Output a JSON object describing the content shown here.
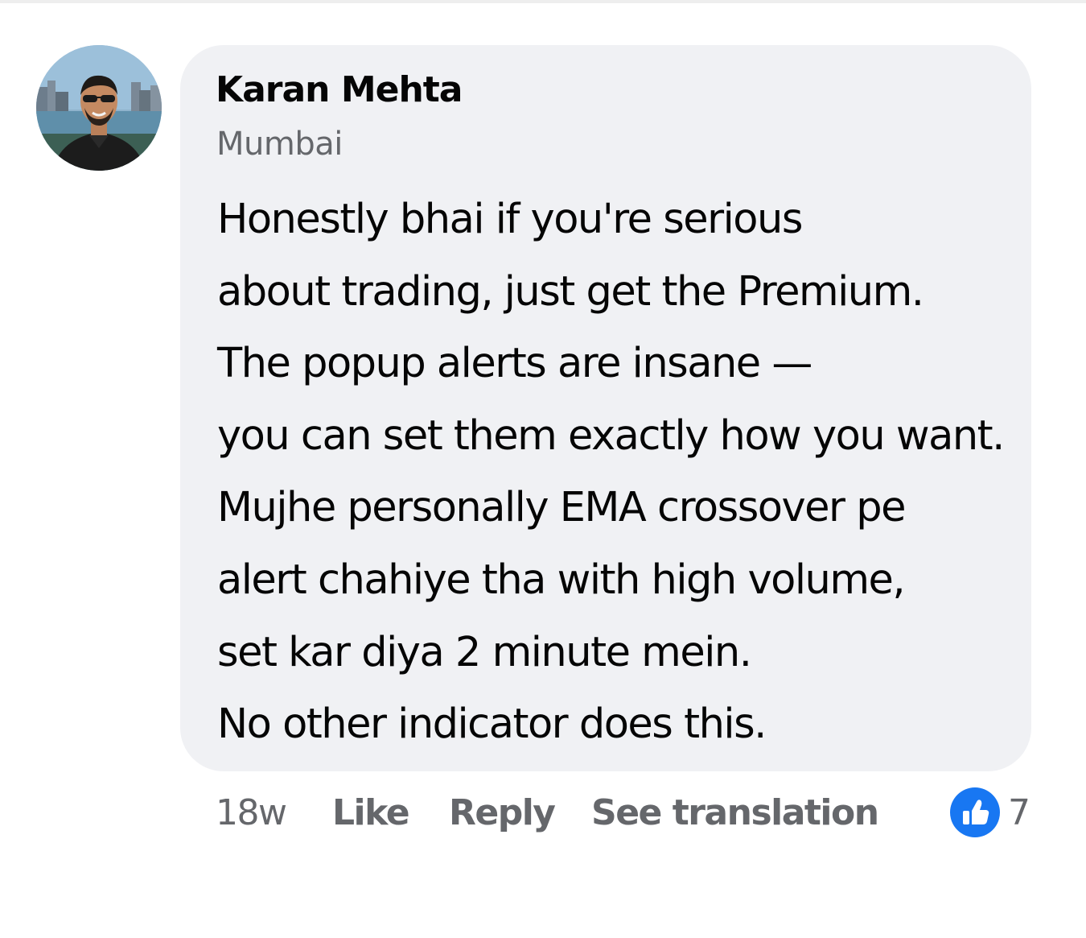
{
  "comment": {
    "author_name": "Karan Mehta",
    "author_location": "Mumbai",
    "avatar_icon": "profile-photo",
    "lines": [
      "Honestly bhai if you're serious",
      "about trading, just get the Premium.",
      "The popup alerts are insane —",
      "you can set them exactly how you want.",
      "Mujhe personally EMA crossover pe",
      "alert chahiye tha with high volume,",
      "set kar diya 2 minute mein.",
      "No other indicator does this."
    ]
  },
  "actions": {
    "timestamp": "18w",
    "like_label": "Like",
    "reply_label": "Reply",
    "translate_label": "See translation"
  },
  "reactions": {
    "icon": "thumbs-up-icon",
    "count": "7",
    "color": "#1877f2"
  },
  "colors": {
    "bubble_background": "#f0f1f4",
    "primary_text": "#050505",
    "secondary_text": "#65676b"
  }
}
